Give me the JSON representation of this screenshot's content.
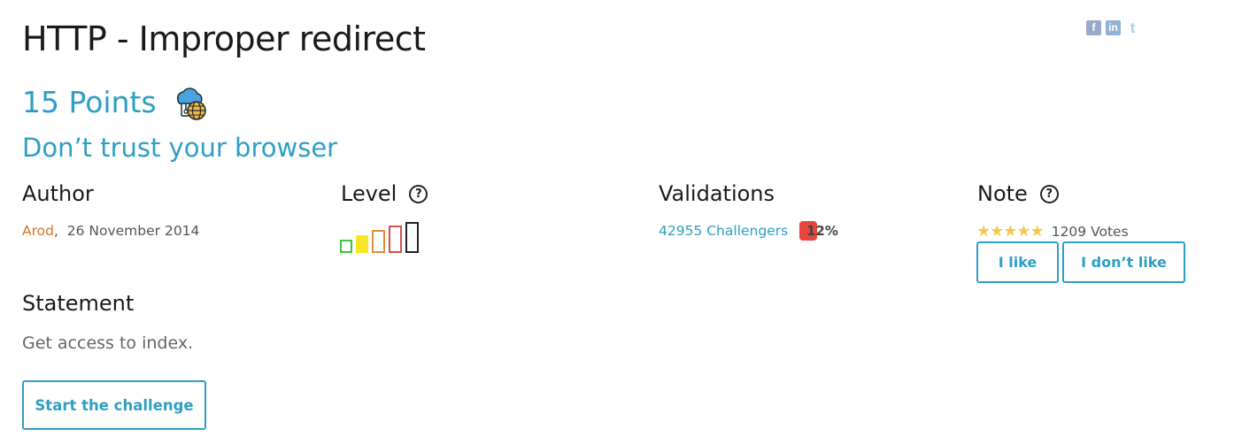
{
  "challenge": {
    "title": "HTTP - Improper redirect",
    "points": "15 Points",
    "category_icon": "cloud-network-globe-icon",
    "subtitle": "Don’t trust your browser"
  },
  "social": {
    "items": [
      {
        "name": "facebook-icon",
        "glyph": "f"
      },
      {
        "name": "linkedin-icon",
        "glyph": "in"
      },
      {
        "name": "twitter-icon",
        "glyph": "t"
      }
    ]
  },
  "author": {
    "heading": "Author",
    "name": "Arod",
    "date": "26 November 2014"
  },
  "level": {
    "heading": "Level",
    "current_level": 2,
    "max_level": 5,
    "colors": [
      "#3cc43c",
      "#f5e728",
      "#e58a3a",
      "#d2524a",
      "#222222"
    ]
  },
  "validations": {
    "heading": "Validations",
    "challengers": "42955 Challengers",
    "percent": "12%"
  },
  "note": {
    "heading": "Note",
    "stars": 5,
    "votes": "1209 Votes",
    "like_label": "I like",
    "dislike_label": "I don’t like"
  },
  "statement": {
    "heading": "Statement",
    "text": "Get access to index.",
    "start_label": "Start the challenge"
  },
  "colors": {
    "accent": "#2e9fc4",
    "author_name": "#d1752a",
    "badge": "#e8453c",
    "star": "#f2c94c"
  }
}
